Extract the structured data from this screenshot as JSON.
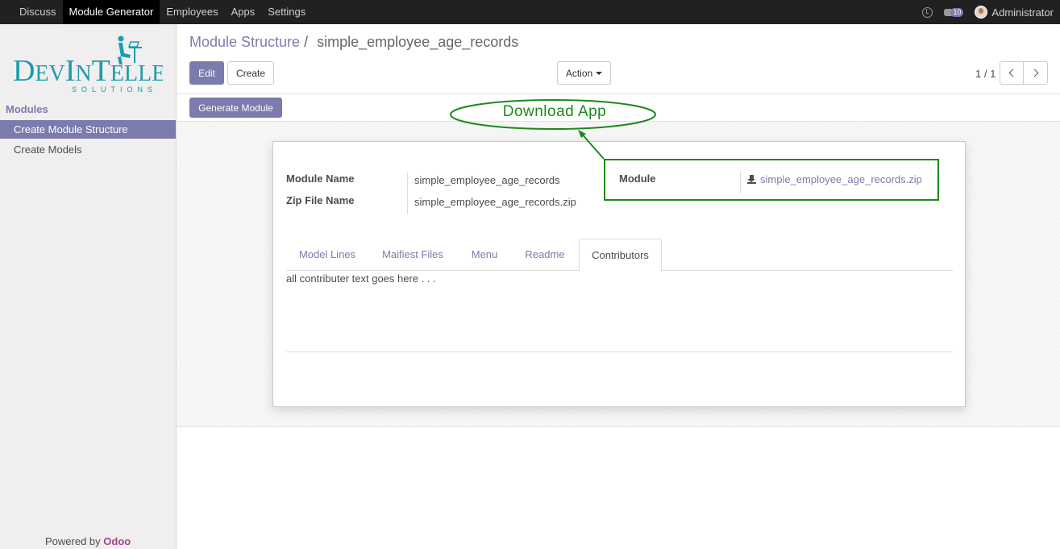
{
  "topbar": {
    "menu": [
      "Discuss",
      "Module Generator",
      "Employees",
      "Apps",
      "Settings"
    ],
    "active_menu": "Module Generator",
    "message_count": "10",
    "user_name": "Administrator"
  },
  "sidebar": {
    "logo": {
      "word": "DevIntelle",
      "tagline": "SOLUTIONS"
    },
    "section_title": "Modules",
    "items": [
      {
        "label": "Create Module Structure",
        "active": true
      },
      {
        "label": "Create Models",
        "active": false
      }
    ],
    "powered_by": "Powered by",
    "powered_brand": "Odoo"
  },
  "breadcrumb": {
    "parent": "Module Structure",
    "separator": "/",
    "current": "simple_employee_age_records"
  },
  "toolbar": {
    "edit_label": "Edit",
    "create_label": "Create",
    "action_label": "Action",
    "pager": "1 / 1"
  },
  "header": {
    "generate_label": "Generate Module"
  },
  "form": {
    "module_name_label": "Module Name",
    "module_name_value": "simple_employee_age_records",
    "zip_file_label": "Zip File Name",
    "zip_file_value": "simple_employee_age_records.zip",
    "module_label": "Module",
    "module_file": "simple_employee_age_records.zip"
  },
  "tabs": {
    "items": [
      "Model Lines",
      "Maifiest Files",
      "Menu",
      "Readme",
      "Contributors"
    ],
    "active": "Contributors",
    "content": "all contributer text goes here . . ."
  },
  "annotation": {
    "text": "Download App",
    "color": "#1a8a1a"
  },
  "colors": {
    "accent": "#7c7bad",
    "topbar": "#212121",
    "brand": "#a24689"
  }
}
